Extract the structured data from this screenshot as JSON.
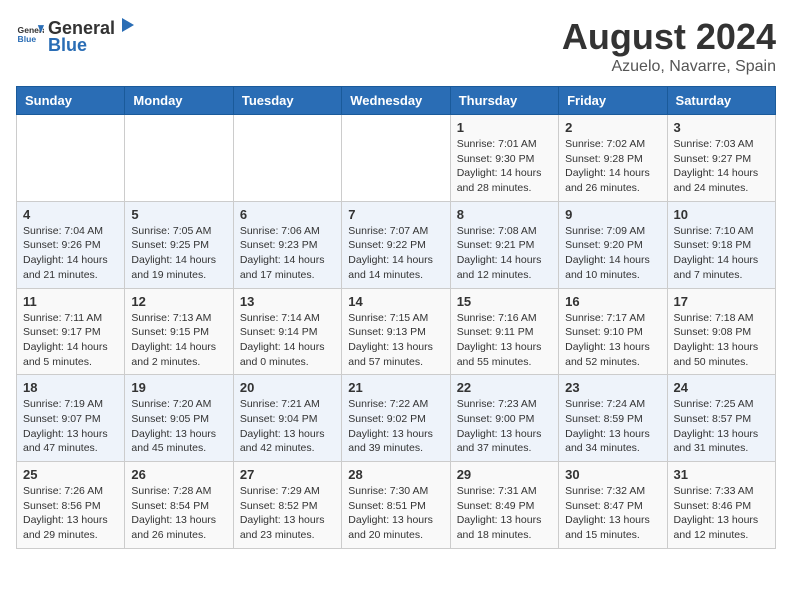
{
  "header": {
    "logo_general": "General",
    "logo_blue": "Blue",
    "month_year": "August 2024",
    "location": "Azuelo, Navarre, Spain"
  },
  "weekdays": [
    "Sunday",
    "Monday",
    "Tuesday",
    "Wednesday",
    "Thursday",
    "Friday",
    "Saturday"
  ],
  "weeks": [
    [
      {
        "day": "",
        "detail": ""
      },
      {
        "day": "",
        "detail": ""
      },
      {
        "day": "",
        "detail": ""
      },
      {
        "day": "",
        "detail": ""
      },
      {
        "day": "1",
        "detail": "Sunrise: 7:01 AM\nSunset: 9:30 PM\nDaylight: 14 hours and 28 minutes."
      },
      {
        "day": "2",
        "detail": "Sunrise: 7:02 AM\nSunset: 9:28 PM\nDaylight: 14 hours and 26 minutes."
      },
      {
        "day": "3",
        "detail": "Sunrise: 7:03 AM\nSunset: 9:27 PM\nDaylight: 14 hours and 24 minutes."
      }
    ],
    [
      {
        "day": "4",
        "detail": "Sunrise: 7:04 AM\nSunset: 9:26 PM\nDaylight: 14 hours and 21 minutes."
      },
      {
        "day": "5",
        "detail": "Sunrise: 7:05 AM\nSunset: 9:25 PM\nDaylight: 14 hours and 19 minutes."
      },
      {
        "day": "6",
        "detail": "Sunrise: 7:06 AM\nSunset: 9:23 PM\nDaylight: 14 hours and 17 minutes."
      },
      {
        "day": "7",
        "detail": "Sunrise: 7:07 AM\nSunset: 9:22 PM\nDaylight: 14 hours and 14 minutes."
      },
      {
        "day": "8",
        "detail": "Sunrise: 7:08 AM\nSunset: 9:21 PM\nDaylight: 14 hours and 12 minutes."
      },
      {
        "day": "9",
        "detail": "Sunrise: 7:09 AM\nSunset: 9:20 PM\nDaylight: 14 hours and 10 minutes."
      },
      {
        "day": "10",
        "detail": "Sunrise: 7:10 AM\nSunset: 9:18 PM\nDaylight: 14 hours and 7 minutes."
      }
    ],
    [
      {
        "day": "11",
        "detail": "Sunrise: 7:11 AM\nSunset: 9:17 PM\nDaylight: 14 hours and 5 minutes."
      },
      {
        "day": "12",
        "detail": "Sunrise: 7:13 AM\nSunset: 9:15 PM\nDaylight: 14 hours and 2 minutes."
      },
      {
        "day": "13",
        "detail": "Sunrise: 7:14 AM\nSunset: 9:14 PM\nDaylight: 14 hours and 0 minutes."
      },
      {
        "day": "14",
        "detail": "Sunrise: 7:15 AM\nSunset: 9:13 PM\nDaylight: 13 hours and 57 minutes."
      },
      {
        "day": "15",
        "detail": "Sunrise: 7:16 AM\nSunset: 9:11 PM\nDaylight: 13 hours and 55 minutes."
      },
      {
        "day": "16",
        "detail": "Sunrise: 7:17 AM\nSunset: 9:10 PM\nDaylight: 13 hours and 52 minutes."
      },
      {
        "day": "17",
        "detail": "Sunrise: 7:18 AM\nSunset: 9:08 PM\nDaylight: 13 hours and 50 minutes."
      }
    ],
    [
      {
        "day": "18",
        "detail": "Sunrise: 7:19 AM\nSunset: 9:07 PM\nDaylight: 13 hours and 47 minutes."
      },
      {
        "day": "19",
        "detail": "Sunrise: 7:20 AM\nSunset: 9:05 PM\nDaylight: 13 hours and 45 minutes."
      },
      {
        "day": "20",
        "detail": "Sunrise: 7:21 AM\nSunset: 9:04 PM\nDaylight: 13 hours and 42 minutes."
      },
      {
        "day": "21",
        "detail": "Sunrise: 7:22 AM\nSunset: 9:02 PM\nDaylight: 13 hours and 39 minutes."
      },
      {
        "day": "22",
        "detail": "Sunrise: 7:23 AM\nSunset: 9:00 PM\nDaylight: 13 hours and 37 minutes."
      },
      {
        "day": "23",
        "detail": "Sunrise: 7:24 AM\nSunset: 8:59 PM\nDaylight: 13 hours and 34 minutes."
      },
      {
        "day": "24",
        "detail": "Sunrise: 7:25 AM\nSunset: 8:57 PM\nDaylight: 13 hours and 31 minutes."
      }
    ],
    [
      {
        "day": "25",
        "detail": "Sunrise: 7:26 AM\nSunset: 8:56 PM\nDaylight: 13 hours and 29 minutes."
      },
      {
        "day": "26",
        "detail": "Sunrise: 7:28 AM\nSunset: 8:54 PM\nDaylight: 13 hours and 26 minutes."
      },
      {
        "day": "27",
        "detail": "Sunrise: 7:29 AM\nSunset: 8:52 PM\nDaylight: 13 hours and 23 minutes."
      },
      {
        "day": "28",
        "detail": "Sunrise: 7:30 AM\nSunset: 8:51 PM\nDaylight: 13 hours and 20 minutes."
      },
      {
        "day": "29",
        "detail": "Sunrise: 7:31 AM\nSunset: 8:49 PM\nDaylight: 13 hours and 18 minutes."
      },
      {
        "day": "30",
        "detail": "Sunrise: 7:32 AM\nSunset: 8:47 PM\nDaylight: 13 hours and 15 minutes."
      },
      {
        "day": "31",
        "detail": "Sunrise: 7:33 AM\nSunset: 8:46 PM\nDaylight: 13 hours and 12 minutes."
      }
    ]
  ]
}
